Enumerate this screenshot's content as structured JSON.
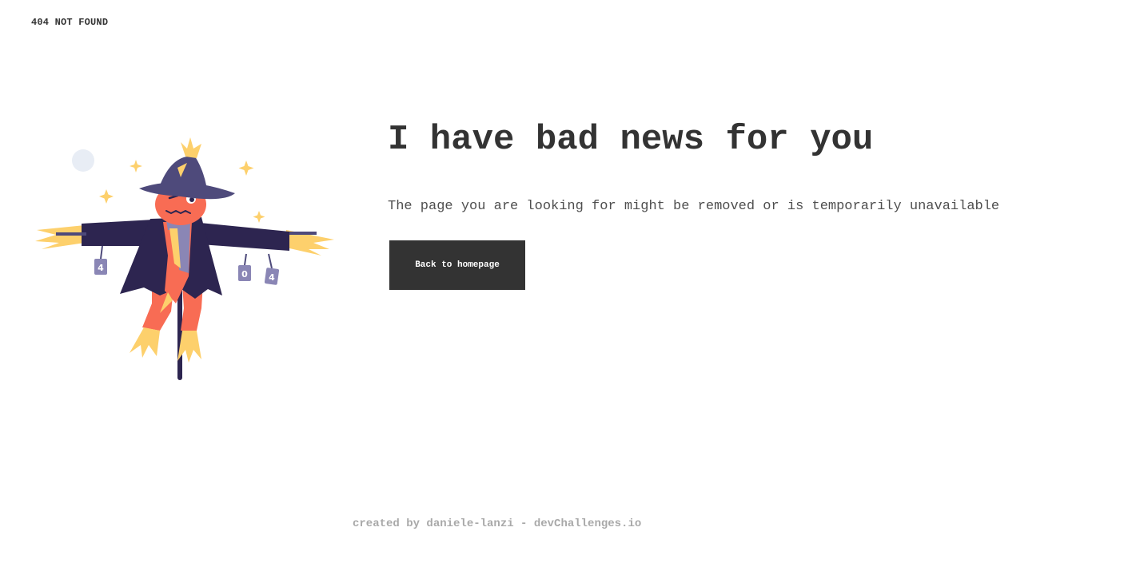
{
  "header": {
    "brand": "404 NOT FOUND"
  },
  "main": {
    "title": "I have bad news for you",
    "message": "The page you are looking for might be removed or is temporarily unavailable",
    "button_label": "Back to homepage"
  },
  "illustration": {
    "subject": "scarecrow-illustration",
    "can_labels": [
      "4",
      "0",
      "4"
    ]
  },
  "footer": {
    "credit": "created by daniele-lanzi - devChallenges.io"
  },
  "colors": {
    "text": "#333333",
    "button_bg": "#333333",
    "button_text": "#ffffff",
    "footer_text": "#a9a9a9",
    "hat": "#4e4a7b",
    "coat": "#2d2550",
    "pants": "#f86c54",
    "straw": "#fdd06c"
  }
}
